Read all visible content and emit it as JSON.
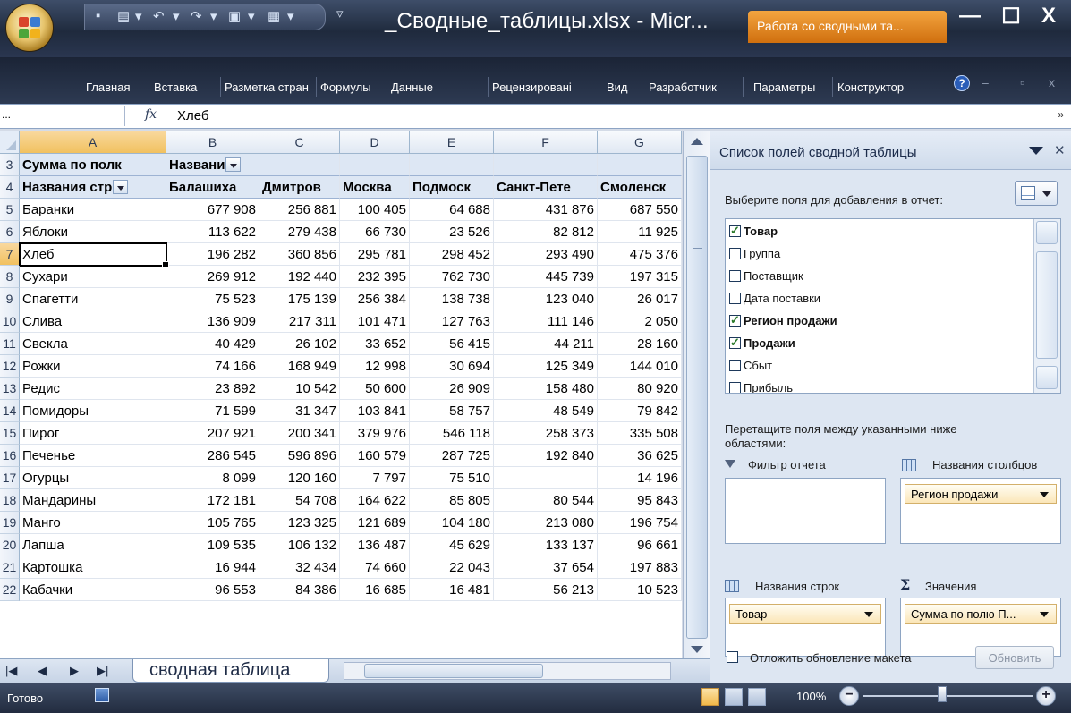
{
  "window": {
    "title": "_Сводные_таблицы.xlsx - Micr...",
    "context_tab": "Работа со сводными та...",
    "minimize": "—",
    "maximize": "☐",
    "close": "X"
  },
  "ribbon_tabs": [
    "Главная",
    "Вставка",
    "Разметка стран",
    "Формулы",
    "Данные",
    "Рецензировані",
    "Вид",
    "Разработчик",
    "Параметры",
    "Конструктор"
  ],
  "ribbon_help": "?",
  "formula_bar": {
    "name_box": "...",
    "fx": "fx",
    "value": "Хлеб",
    "expand": "»"
  },
  "grid": {
    "columns": [
      "A",
      "B",
      "C",
      "D",
      "E",
      "F",
      "G"
    ],
    "selected_column": "A",
    "selected_row": "7",
    "header_row": {
      "row": "3",
      "a": "Сумма по полк",
      "b": "Названи"
    },
    "col_labels_row": {
      "row": "4",
      "cells": [
        "Названия стр",
        "Балашиха",
        "Дмитров",
        "Москва",
        "Подмоск",
        "Санкт-Пете",
        "Смоленск"
      ]
    },
    "rows": [
      {
        "n": "5",
        "cells": [
          "Баранки",
          "677 908",
          "256 881",
          "100 405",
          "64 688",
          "431 876",
          "687 550"
        ]
      },
      {
        "n": "6",
        "cells": [
          "Яблоки",
          "113 622",
          "279 438",
          "66 730",
          "23 526",
          "82 812",
          "11 925"
        ]
      },
      {
        "n": "7",
        "cells": [
          "Хлеб",
          "196 282",
          "360 856",
          "295 781",
          "298 452",
          "293 490",
          "475 376"
        ]
      },
      {
        "n": "8",
        "cells": [
          "Сухари",
          "269 912",
          "192 440",
          "232 395",
          "762 730",
          "445 739",
          "197 315"
        ]
      },
      {
        "n": "9",
        "cells": [
          "Спагетти",
          "75 523",
          "175 139",
          "256 384",
          "138 738",
          "123 040",
          "26 017"
        ]
      },
      {
        "n": "10",
        "cells": [
          "Слива",
          "136 909",
          "217 311",
          "101 471",
          "127 763",
          "111 146",
          "2 050"
        ]
      },
      {
        "n": "11",
        "cells": [
          "Свекла",
          "40 429",
          "26 102",
          "33 652",
          "56 415",
          "44 211",
          "28 160"
        ]
      },
      {
        "n": "12",
        "cells": [
          "Рожки",
          "74 166",
          "168 949",
          "12 998",
          "30 694",
          "125 349",
          "144 010"
        ]
      },
      {
        "n": "13",
        "cells": [
          "Редис",
          "23 892",
          "10 542",
          "50 600",
          "26 909",
          "158 480",
          "80 920"
        ]
      },
      {
        "n": "14",
        "cells": [
          "Помидоры",
          "71 599",
          "31 347",
          "103 841",
          "58 757",
          "48 549",
          "79 842"
        ]
      },
      {
        "n": "15",
        "cells": [
          "Пирог",
          "207 921",
          "200 341",
          "379 976",
          "546 118",
          "258 373",
          "335 508"
        ]
      },
      {
        "n": "16",
        "cells": [
          "Печенье",
          "286 545",
          "596 896",
          "160 579",
          "287 725",
          "192 840",
          "36 625"
        ]
      },
      {
        "n": "17",
        "cells": [
          "Огурцы",
          "8 099",
          "120 160",
          "7 797",
          "75 510",
          "",
          "14 196"
        ]
      },
      {
        "n": "18",
        "cells": [
          "Мандарины",
          "172 181",
          "54 708",
          "164 622",
          "85 805",
          "80 544",
          "95 843"
        ]
      },
      {
        "n": "19",
        "cells": [
          "Манго",
          "105 765",
          "123 325",
          "121 689",
          "104 180",
          "213 080",
          "196 754"
        ]
      },
      {
        "n": "20",
        "cells": [
          "Лапша",
          "109 535",
          "106 132",
          "136 487",
          "45 629",
          "133 137",
          "96 661"
        ]
      },
      {
        "n": "21",
        "cells": [
          "Картошка",
          "16 944",
          "32 434",
          "74 660",
          "22 043",
          "37 654",
          "197 883"
        ]
      },
      {
        "n": "22",
        "cells": [
          "Кабачки",
          "96 553",
          "84 386",
          "16 685",
          "16 481",
          "56 213",
          "10 523"
        ]
      }
    ]
  },
  "sheet_tabs": {
    "active": "сводная таблица"
  },
  "status": {
    "text": "Готово",
    "zoom": "100%"
  },
  "pivot_panel": {
    "title": "Список полей сводной таблицы",
    "choose_label": "Выберите поля для добавления в отчет:",
    "fields": [
      {
        "label": "Товар",
        "checked": true
      },
      {
        "label": "Группа",
        "checked": false
      },
      {
        "label": "Поставщик",
        "checked": false
      },
      {
        "label": "Дата поставки",
        "checked": false
      },
      {
        "label": "Регион продажи",
        "checked": true
      },
      {
        "label": "Продажи",
        "checked": true
      },
      {
        "label": "Сбыт",
        "checked": false
      },
      {
        "label": "Прибыль",
        "checked": false
      }
    ],
    "drag_text": "Перетащите поля между указанными ниже областями:",
    "areas": {
      "report_filter": "Фильтр отчета",
      "column_labels": "Названия столбцов",
      "column_item": "Регион продажи",
      "row_labels": "Названия строк",
      "row_item": "Товар",
      "values": "Значения",
      "values_item": "Сумма по полю П..."
    },
    "defer_label": "Отложить обновление макета",
    "update_button": "Обновить"
  }
}
